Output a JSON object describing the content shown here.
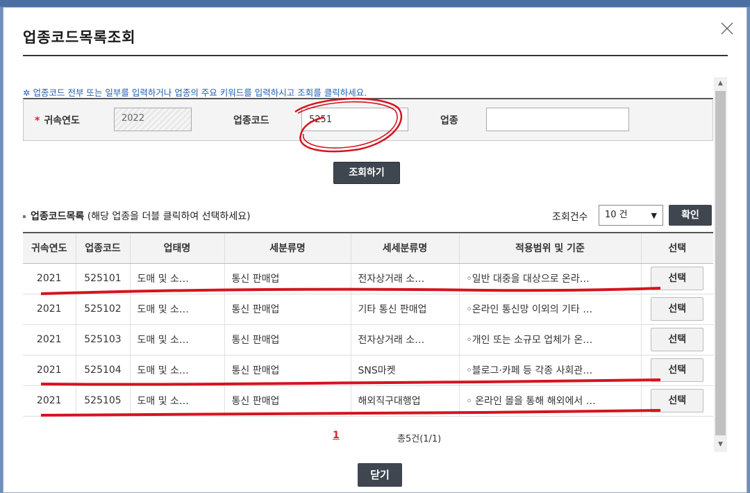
{
  "modal": {
    "title": "업종코드목록조회"
  },
  "search": {
    "hint": "업종코드 전부 또는 일부를 입력하거나 업종의 주요 키워드를 입력하시고 조회를 클릭하세요.",
    "year_label": "귀속연도",
    "year_value": "2022",
    "code_label": "업종코드",
    "code_value": "5251",
    "industry_label": "업종",
    "industry_value": "",
    "search_button": "조회하기"
  },
  "list": {
    "title": "업종코드목록",
    "subtitle": "(해당 업종을 더블 클릭하여 선택하세요)",
    "count_label": "조회건수",
    "count_value": "10 건",
    "confirm_button": "확인",
    "columns": [
      "귀속연도",
      "업종코드",
      "업태명",
      "세분류명",
      "세세분류명",
      "적용범위 및 기준",
      "선택"
    ],
    "rows": [
      {
        "year": "2021",
        "code": "525101",
        "business": "도매 및 소…",
        "sub": "통신 판매업",
        "subsub": "전자상거래 소…",
        "scope": "◦일반 대중을 대상으로 온라…",
        "action": "선택"
      },
      {
        "year": "2021",
        "code": "525102",
        "business": "도매 및 소…",
        "sub": "통신 판매업",
        "subsub": "기타 통신 판매업",
        "scope": "◦온라인 통신망 이외의 기타 …",
        "action": "선택"
      },
      {
        "year": "2021",
        "code": "525103",
        "business": "도매 및 소…",
        "sub": "통신 판매업",
        "subsub": "전자상거래 소…",
        "scope": "◦개인 또는 소규모 업체가 온…",
        "action": "선택"
      },
      {
        "year": "2021",
        "code": "525104",
        "business": "도매 및 소…",
        "sub": "통신 판매업",
        "subsub": "SNS마켓",
        "scope": "◦블로그·카페 등 각종 사회관…",
        "action": "선택"
      },
      {
        "year": "2021",
        "code": "525105",
        "business": "도매 및 소…",
        "sub": "통신 판매업",
        "subsub": "해외직구대행업",
        "scope": "◦ 온라인 몰을 통해 해외에서 …",
        "action": "선택"
      }
    ]
  },
  "pagination": {
    "current_page": "1",
    "total": "총5건(1/1)"
  },
  "footer": {
    "close_button": "닫기"
  },
  "colors": {
    "dark_button": "#3f4650",
    "required": "#d6222a",
    "hint": "#1f5fb0",
    "annotation": "#d4141e"
  }
}
